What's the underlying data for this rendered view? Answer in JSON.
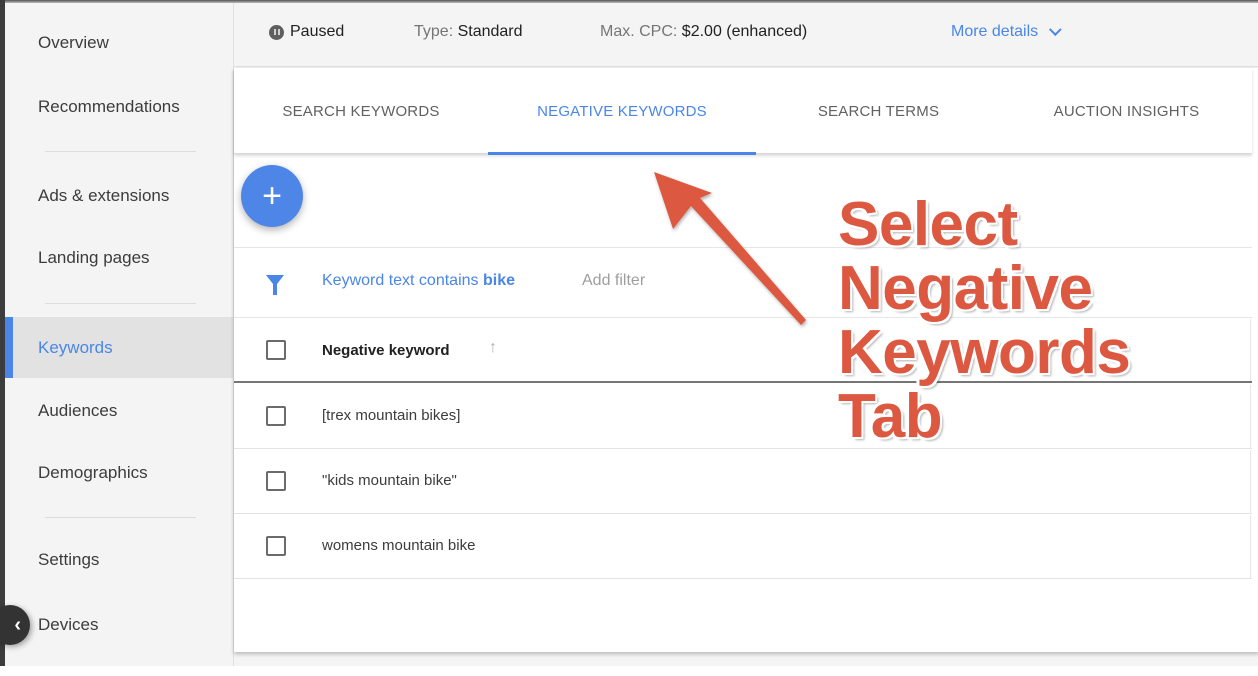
{
  "sidebar": {
    "items": [
      {
        "label": "Overview",
        "active": false
      },
      {
        "label": "Recommendations",
        "active": false
      },
      {
        "label": "Ads & extensions",
        "active": false
      },
      {
        "label": "Landing pages",
        "active": false
      },
      {
        "label": "Keywords",
        "active": true
      },
      {
        "label": "Audiences",
        "active": false
      },
      {
        "label": "Demographics",
        "active": false
      },
      {
        "label": "Settings",
        "active": false
      },
      {
        "label": "Devices",
        "active": false
      }
    ],
    "collapse_icon": "chevron-left-icon"
  },
  "status_bar": {
    "status": "Paused",
    "status_icon": "pause-circle-icon",
    "type_label": "Type:",
    "type_value": "Standard",
    "cpc_label": "Max. CPC:",
    "cpc_value": "$2.00 (enhanced)",
    "more_details": "More details"
  },
  "tabs": [
    {
      "label": "SEARCH KEYWORDS",
      "active": false
    },
    {
      "label": "NEGATIVE KEYWORDS",
      "active": true
    },
    {
      "label": "SEARCH TERMS",
      "active": false
    },
    {
      "label": "AUCTION INSIGHTS",
      "active": false
    }
  ],
  "fab": {
    "icon": "plus-icon",
    "symbol": "+"
  },
  "filter": {
    "prefix": "Keyword text contains",
    "value": "bike",
    "add_filter": "Add filter"
  },
  "table": {
    "header": "Negative keyword",
    "sort_icon": "↑",
    "rows": [
      {
        "keyword": "[trex mountain bikes]"
      },
      {
        "keyword": "\"kids mountain bike\""
      },
      {
        "keyword": "womens mountain bike"
      }
    ]
  },
  "annotation": {
    "lines": [
      "Select",
      "Negative",
      "Keywords",
      "Tab"
    ],
    "color": "#dd5840"
  },
  "colors": {
    "accent": "#4a86e8",
    "sidebar_bg": "#f4f4f4",
    "annotation": "#dd5840"
  }
}
